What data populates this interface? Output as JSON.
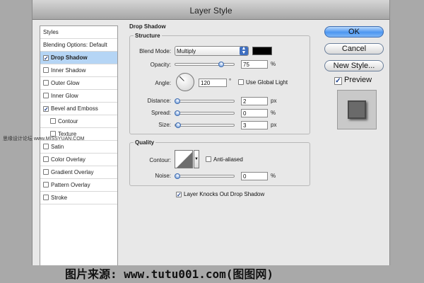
{
  "window": {
    "title": "Layer Style"
  },
  "styles_panel": {
    "items": [
      {
        "label": "Styles",
        "checkbox": false,
        "checked": false
      },
      {
        "label": "Blending Options: Default",
        "checkbox": false,
        "checked": false
      },
      {
        "label": "Drop Shadow",
        "checkbox": true,
        "checked": true
      },
      {
        "label": "Inner Shadow",
        "checkbox": true,
        "checked": false
      },
      {
        "label": "Outer Glow",
        "checkbox": true,
        "checked": false
      },
      {
        "label": "Inner Glow",
        "checkbox": true,
        "checked": false
      },
      {
        "label": "Bevel and Emboss",
        "checkbox": true,
        "checked": true
      },
      {
        "label": "Contour",
        "checkbox": true,
        "checked": false
      },
      {
        "label": "Texture",
        "checkbox": true,
        "checked": false
      },
      {
        "label": "Satin",
        "checkbox": true,
        "checked": false
      },
      {
        "label": "Color Overlay",
        "checkbox": true,
        "checked": false
      },
      {
        "label": "Gradient Overlay",
        "checkbox": true,
        "checked": false
      },
      {
        "label": "Pattern Overlay",
        "checkbox": true,
        "checked": false
      },
      {
        "label": "Stroke",
        "checkbox": true,
        "checked": false
      }
    ]
  },
  "drop_shadow": {
    "section_title": "Drop Shadow",
    "structure": {
      "title": "Structure",
      "blend_mode_label": "Blend Mode:",
      "blend_mode_value": "Multiply",
      "shadow_color": "#000000",
      "opacity_label": "Opacity:",
      "opacity_value": "75",
      "opacity_unit": "%",
      "angle_label": "Angle:",
      "angle_value": "120",
      "angle_unit": "°",
      "use_global_light_label": "Use Global Light",
      "distance_label": "Distance:",
      "distance_value": "2",
      "distance_unit": "px",
      "spread_label": "Spread:",
      "spread_value": "0",
      "spread_unit": "%",
      "size_label": "Size:",
      "size_value": "3",
      "size_unit": "px"
    },
    "quality": {
      "title": "Quality",
      "contour_label": "Contour:",
      "anti_aliased_label": "Anti-aliased",
      "noise_label": "Noise:",
      "noise_value": "0",
      "noise_unit": "%"
    },
    "knockout_label": "Layer Knocks Out Drop Shadow"
  },
  "buttons": {
    "ok": "OK",
    "cancel": "Cancel",
    "new_style": "New Style...",
    "preview_label": "Preview"
  },
  "watermarks": {
    "side": "思缘设计论坛  www.MISSYUAN.COM",
    "bottom": "图片来源: www.tutu001.com(图图网)"
  },
  "colors": {
    "accent": "#4d97f1",
    "selection": "#b5d5f5"
  }
}
